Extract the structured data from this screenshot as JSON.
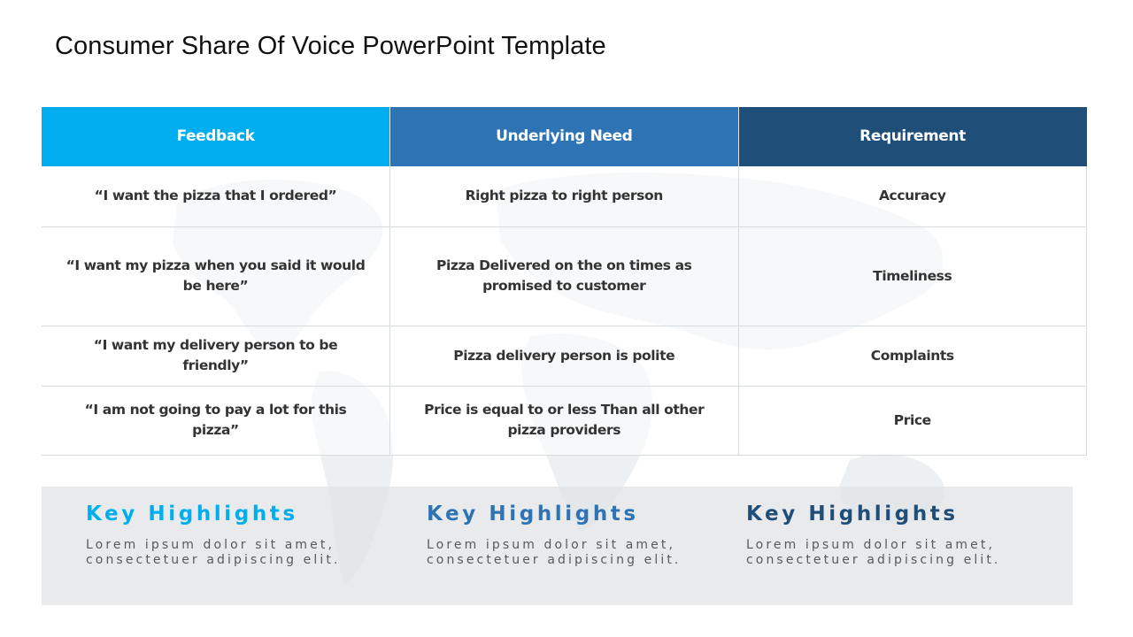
{
  "title": "Consumer Share Of Voice PowerPoint Template",
  "colors": {
    "feedback_header": "#00aeef",
    "need_header": "#2e74b5",
    "requirement_header": "#1f4e79",
    "highlight_panel": "#e6e7e9"
  },
  "table": {
    "headers": [
      "Feedback",
      "Underlying Need",
      "Requirement"
    ],
    "rows": [
      {
        "feedback": "“I want the pizza that I ordered”",
        "need": "Right pizza to right  person",
        "requirement": "Accuracy"
      },
      {
        "feedback": "“I want my pizza when you said it would be here”",
        "need": "Pizza Delivered on the on times as promised to customer",
        "requirement": "Timeliness"
      },
      {
        "feedback": "“I want my delivery person to be friendly”",
        "need": "Pizza delivery person is polite",
        "requirement": "Complaints"
      },
      {
        "feedback": "“I am not going to pay a lot for this pizza”",
        "need": "Price is equal to or less Than all other pizza providers",
        "requirement": "Price"
      }
    ]
  },
  "highlights": [
    {
      "title": "Key Highlights",
      "text": "Lorem ipsum dolor sit amet,\nconsectetuer adipiscing elit."
    },
    {
      "title": "Key Highlights",
      "text": "Lorem ipsum dolor sit amet,\nconsectetuer adipiscing elit."
    },
    {
      "title": "Key Highlights",
      "text": "Lorem ipsum dolor sit amet,\nconsectetuer adipiscing elit."
    }
  ]
}
